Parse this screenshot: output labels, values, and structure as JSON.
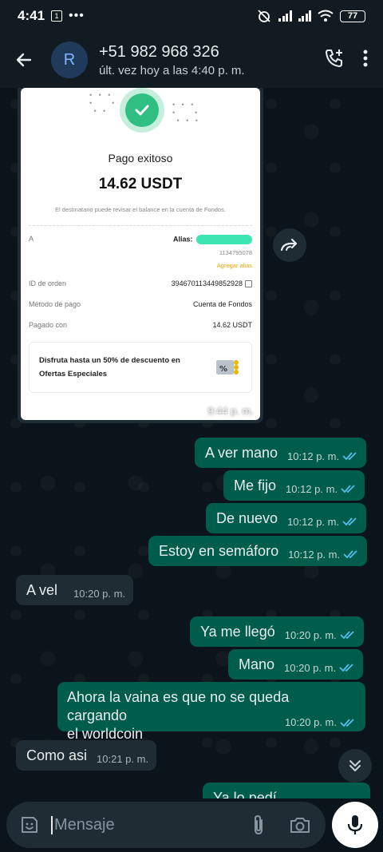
{
  "statusbar": {
    "time": "4:41",
    "notif_count": "1",
    "battery": "77"
  },
  "header": {
    "avatar_letter": "R",
    "contact_name": "+51 982 968 326",
    "last_seen": "últ. vez hoy a las 4:40 p. m."
  },
  "receipt": {
    "title": "Pago exitoso",
    "amount": "14.62 USDT",
    "note": "El destinatario puede revisar el balance en la cuenta de Fondos.",
    "to_label": "A",
    "alias_label": "Alias: ",
    "alias_id": "1134795078",
    "add_alias": "Agregar alias",
    "order_label": "ID de orden",
    "order_value": "394670113449852928",
    "method_label": "Método de pago",
    "method_value": "Cuenta de Fondos",
    "paid_label": "Pagado con",
    "paid_value": "14.62 USDT",
    "promo_line1": "Disfruta hasta un 50% de descuento en",
    "promo_line2": "Ofertas Especiales",
    "time": "9:44 p. m."
  },
  "messages": [
    {
      "dir": "out",
      "text": "A ver mano",
      "time": "10:12 p. m."
    },
    {
      "dir": "out",
      "text": "Me fijo",
      "time": "10:12 p. m."
    },
    {
      "dir": "out",
      "text": "De nuevo",
      "time": "10:12 p. m."
    },
    {
      "dir": "out",
      "text": "Estoy en semáforo",
      "time": "10:12 p. m."
    },
    {
      "dir": "in",
      "text": "A vel",
      "time": "10:20 p. m."
    },
    {
      "dir": "out",
      "text": "Ya me llegó",
      "time": "10:20 p. m."
    },
    {
      "dir": "out",
      "text": "Mano",
      "time": "10:20 p. m."
    },
    {
      "dir": "out",
      "text_line1": "Ahora la vaina es que no se queda cargando",
      "text_line2": "el worldcoin",
      "time": "10:20 p. m."
    },
    {
      "dir": "in",
      "text": "Como asi",
      "time": "10:21 p. m."
    },
    {
      "dir": "out",
      "text": "Ya lo pedí",
      "time": ""
    }
  ],
  "input": {
    "placeholder": "Mensaje"
  },
  "colors": {
    "outgoing_bubble": "#005c4b",
    "incoming_bubble": "#202c33",
    "read_ticks": "#53bdeb",
    "background": "#0b141a"
  }
}
